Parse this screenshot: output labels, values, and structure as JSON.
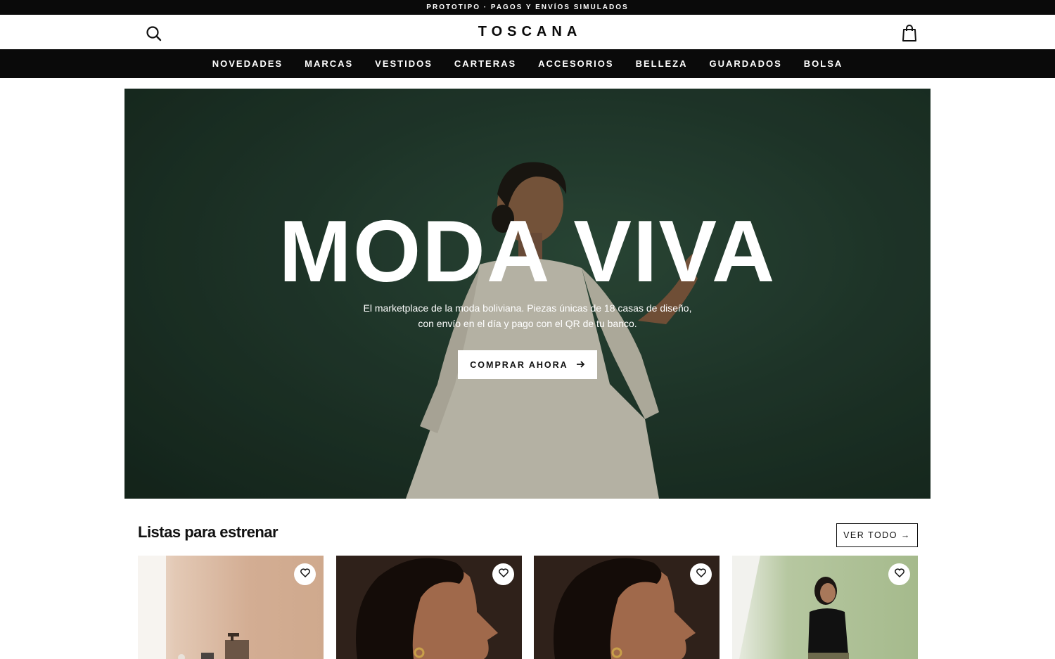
{
  "announcement": "PROTOTIPO · PAGOS Y ENVÍOS SIMULADOS",
  "header": {
    "brand": "TOSCANA",
    "search_icon": "search-icon",
    "bag_icon": "shopping-bag-icon"
  },
  "nav": {
    "items": [
      "NOVEDADES",
      "MARCAS",
      "VESTIDOS",
      "CARTERAS",
      "ACCESORIOS",
      "BELLEZA",
      "GUARDADOS",
      "BOLSA"
    ]
  },
  "hero": {
    "title": "MODA VIVA",
    "subtitle_line1": "El marketplace de la moda boliviana. Piezas únicas de 18 casas de diseño,",
    "subtitle_line2": "con envío en el día y pago con el QR de tu banco.",
    "cta_label": "COMPRAR AHORA",
    "cta_icon": "arrow-right-icon"
  },
  "section": {
    "title": "Listas para estrenar",
    "view_all": "VER TODO →"
  },
  "products": [
    {
      "image": "beauty-bottles-photo",
      "favorite_icon": "heart-icon"
    },
    {
      "image": "woman-profile-earring-photo",
      "favorite_icon": "heart-icon"
    },
    {
      "image": "woman-profile-earring-photo",
      "favorite_icon": "heart-icon"
    },
    {
      "image": "woman-black-top-green-backdrop-photo",
      "favorite_icon": "heart-icon"
    }
  ],
  "colors": {
    "bar_black": "#0a0a0a",
    "hero_green": "#22392d",
    "white": "#ffffff"
  }
}
